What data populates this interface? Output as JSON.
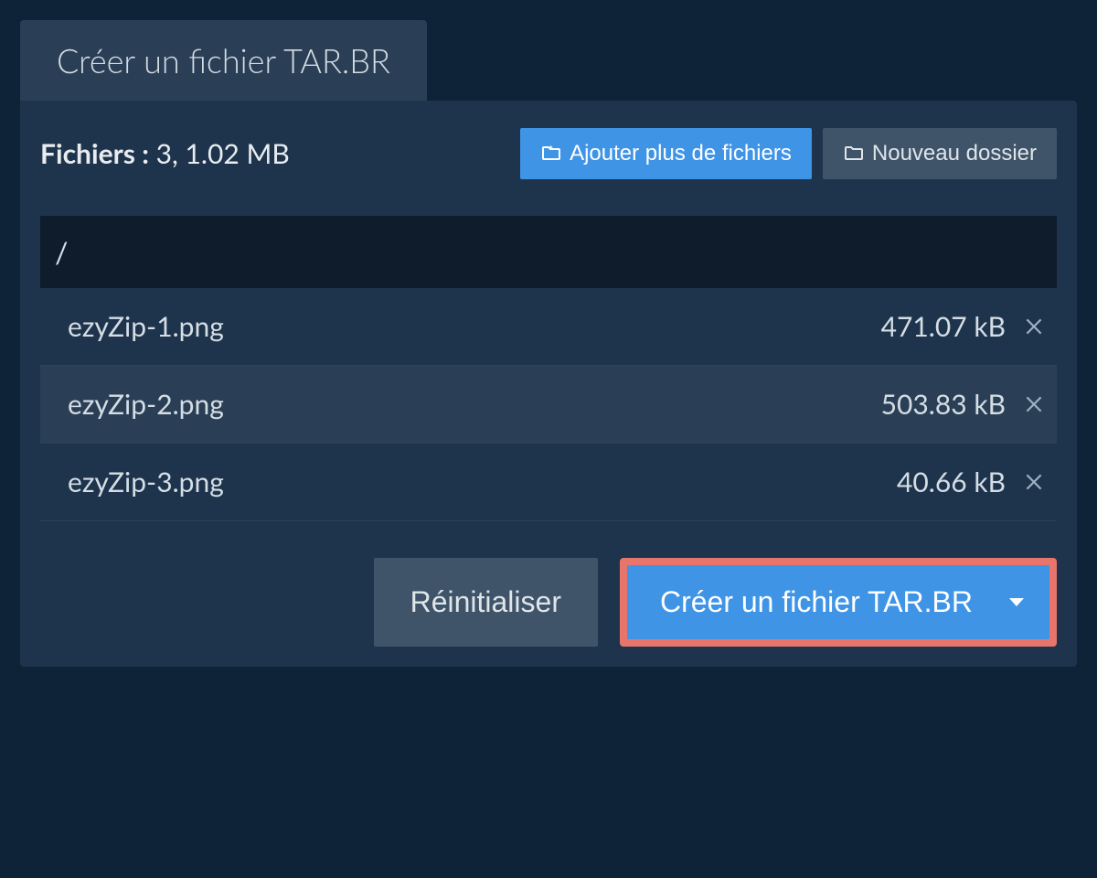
{
  "tab": {
    "title": "Créer un fichier TAR.BR"
  },
  "summary": {
    "label": "Fichiers :",
    "count_size": "3, 1.02 MB"
  },
  "buttons": {
    "add_files": "Ajouter plus de fichiers",
    "new_folder": "Nouveau dossier",
    "reset": "Réinitialiser",
    "create": "Créer un fichier TAR.BR"
  },
  "breadcrumb": "/",
  "files": [
    {
      "name": "ezyZip-1.png",
      "size": "471.07 kB"
    },
    {
      "name": "ezyZip-2.png",
      "size": "503.83 kB"
    },
    {
      "name": "ezyZip-3.png",
      "size": "40.66 kB"
    }
  ]
}
